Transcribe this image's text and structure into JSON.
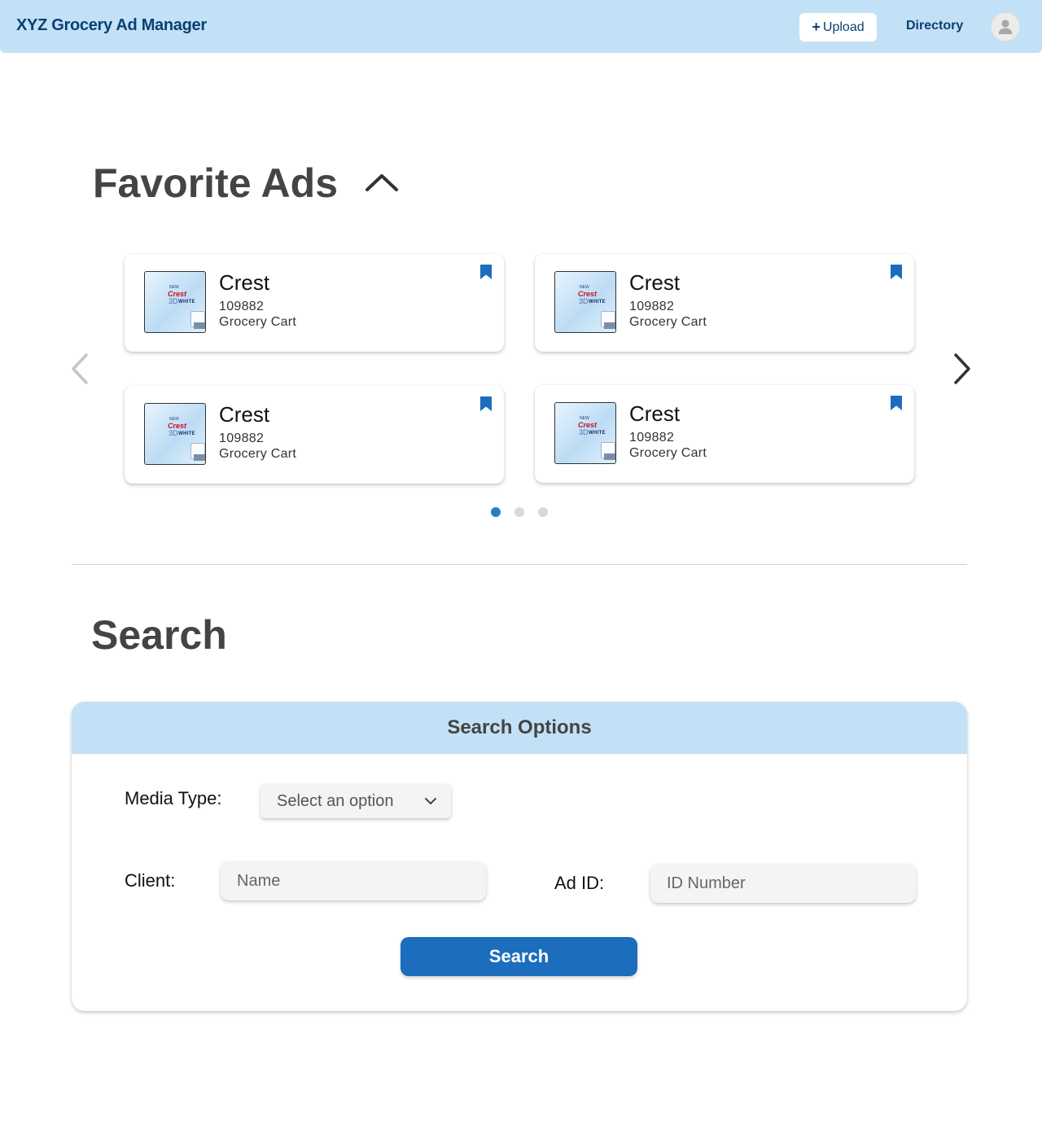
{
  "header": {
    "app_title": "XYZ Grocery Ad Manager",
    "upload_plus": "+",
    "upload_label": "Upload",
    "directory_label": "Directory",
    "avatar_icon": "user-avatar-icon"
  },
  "favorites": {
    "title": "Favorite Ads",
    "collapse_icon": "chevron-up-icon",
    "prev_icon": "chevron-left-icon",
    "next_icon": "chevron-right-icon",
    "cards": [
      {
        "name": "Crest",
        "id": "109882",
        "media_type": "Grocery Cart",
        "bookmarked": true
      },
      {
        "name": "Crest",
        "id": "109882",
        "media_type": "Grocery Cart",
        "bookmarked": true
      },
      {
        "name": "Crest",
        "id": "109882",
        "media_type": "Grocery Cart",
        "bookmarked": true
      },
      {
        "name": "Crest",
        "id": "109882",
        "media_type": "Grocery Cart",
        "bookmarked": true
      }
    ],
    "thumbnail": {
      "line1": "NEW",
      "line2": "Crest",
      "line3": "3D",
      "line4": "WHITE"
    },
    "pagination": {
      "pages": 3,
      "active": 1
    }
  },
  "search": {
    "title": "Search",
    "panel_title": "Search Options",
    "media_type_label": "Media Type:",
    "media_type_value": "Select an option",
    "client_label": "Client:",
    "client_placeholder": "Name",
    "ad_id_label": "Ad ID:",
    "ad_id_placeholder": "ID Number",
    "search_button": "Search"
  },
  "colors": {
    "header_bg": "#c3e1f6",
    "brand_text": "#0b3f73",
    "accent": "#1c6dbd",
    "bookmark": "#1c6dbd",
    "active_dot": "#1f82c9"
  }
}
